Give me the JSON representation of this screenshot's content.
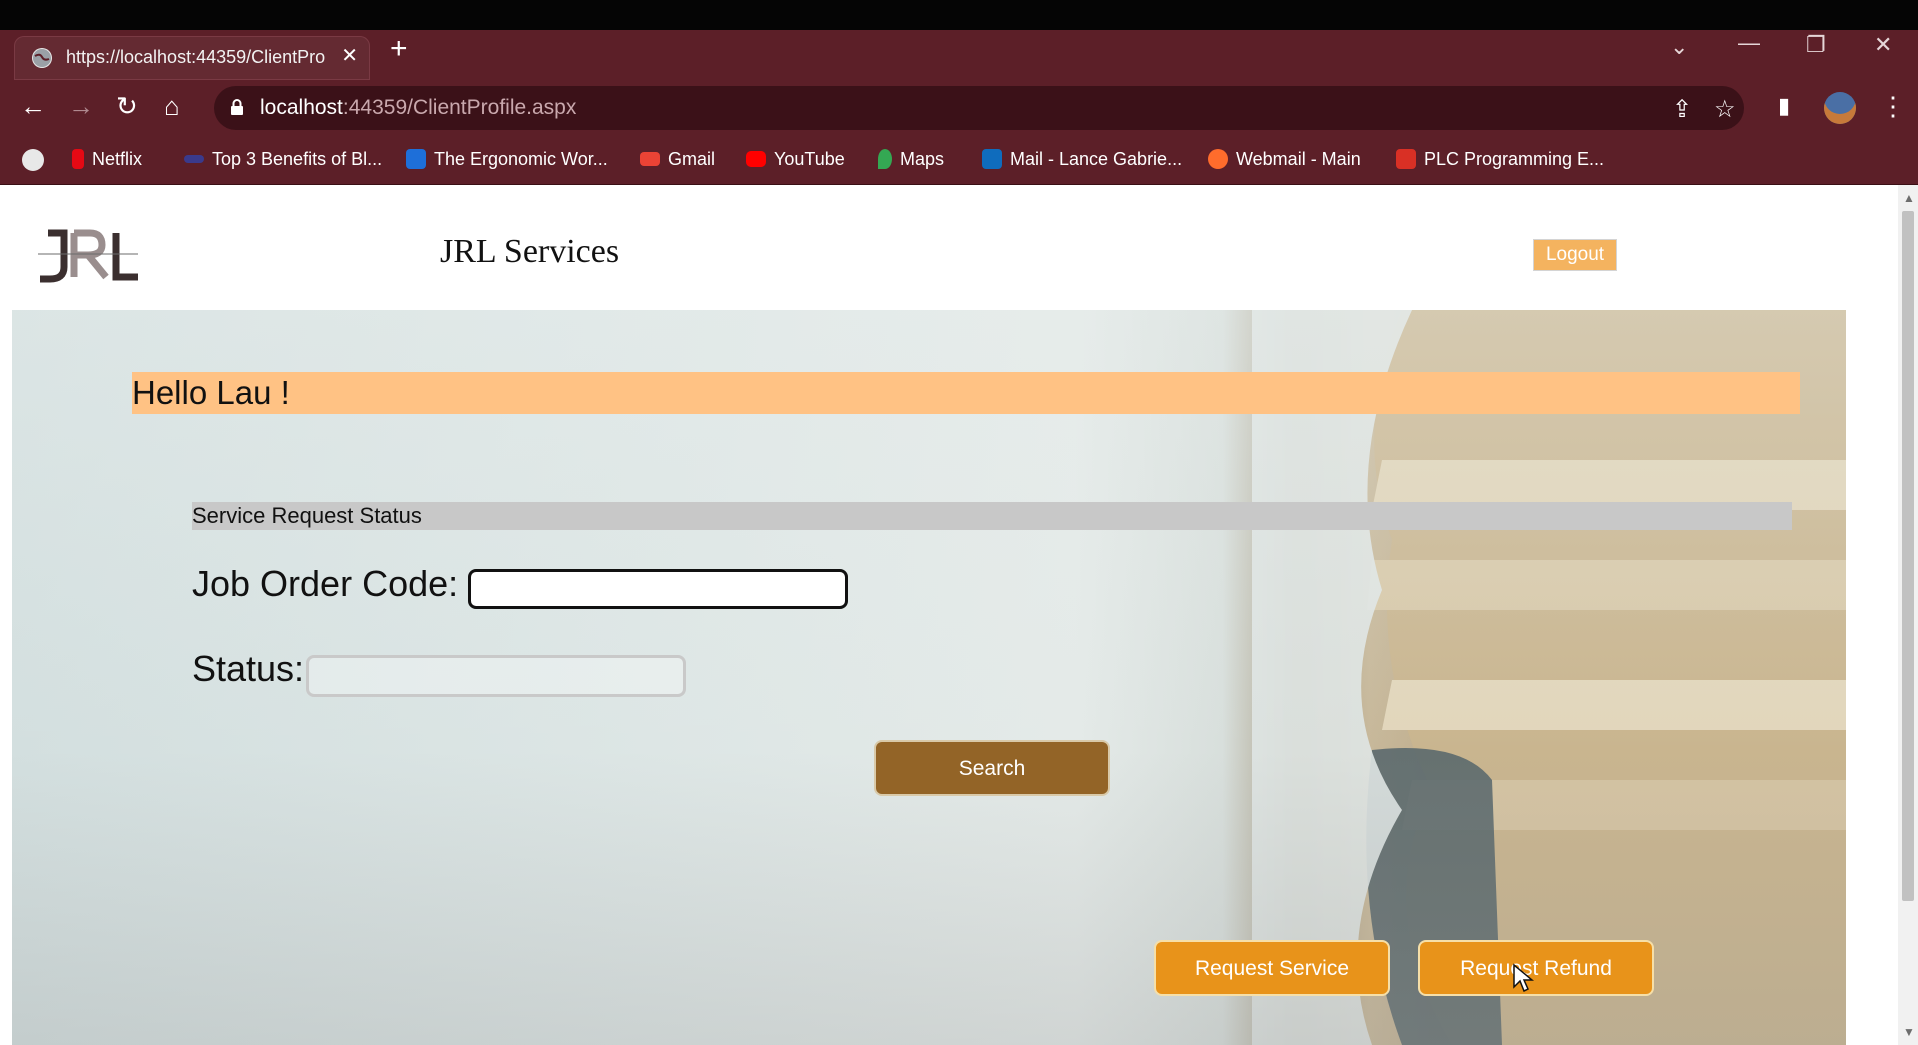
{
  "browser": {
    "tab_title": "https://localhost:44359/ClientPro",
    "url_host": "localhost",
    "url_rest": ":44359/ClientProfile.aspx",
    "bookmarks": [
      {
        "label": "Netflix",
        "icon": "netflix-icon",
        "color": "#e50914"
      },
      {
        "label": "Top 3 Benefits of Bl...",
        "icon": "site-icon",
        "color": "#3a3a8c"
      },
      {
        "label": "The Ergonomic Wor...",
        "icon": "pt-icon",
        "color": "#1e6fd9"
      },
      {
        "label": "Gmail",
        "icon": "gmail-icon",
        "color": "#ea4335"
      },
      {
        "label": "YouTube",
        "icon": "youtube-icon",
        "color": "#ff0000"
      },
      {
        "label": "Maps",
        "icon": "maps-icon",
        "color": "#34a853"
      },
      {
        "label": "Mail - Lance Gabrie...",
        "icon": "outlook-icon",
        "color": "#0f6cbd"
      },
      {
        "label": "Webmail - Main",
        "icon": "cpanel-icon",
        "color": "#ff6c2c"
      },
      {
        "label": "PLC Programming E...",
        "icon": "plc-icon",
        "color": "#d93025"
      }
    ]
  },
  "site": {
    "title": "JRL Services",
    "logout_label": "Logout",
    "greeting": "Hello Lau !",
    "section_title": "Service Request Status",
    "job_order_label": "Job Order Code:",
    "job_order_value": "",
    "status_label": "Status:",
    "status_value": "",
    "search_label": "Search",
    "request_service_label": "Request Service",
    "request_refund_label": "Request Refund"
  },
  "colors": {
    "accent_orange": "#e8931a",
    "greeting_bg": "#ffc284",
    "search_brown": "#936427",
    "browser_frame": "#5c1f28"
  }
}
